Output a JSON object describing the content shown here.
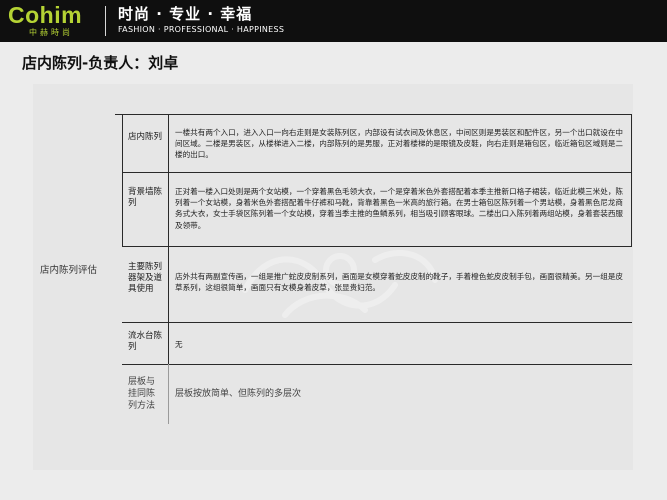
{
  "header": {
    "brand_name": "Cohim",
    "brand_sub": "中赫時尚",
    "slogan_cn": "时尚 · 专业 · 幸福",
    "slogan_en": "FASHION · PROFESSIONAL · HAPPINESS"
  },
  "title": "店内陈列-负责人：刘卓",
  "table": {
    "group_label": "店内陈列评估",
    "rows": [
      {
        "label": "店内陈列",
        "content": "一楼共有两个入口，进入入口一向右走则是女装陈列区，内部设有试衣间及休息区，中间区则是男装区和配件区，另一个出口就设在中间区域。二楼是男装区，从楼梯进入二楼，内部陈列的是男服，正对着楼梯的是眼镜及皮鞋，向右走则是箱包区，临近箱包区域则是二楼的出口。"
      },
      {
        "label": "背景墙陈列",
        "content": "正对着一楼入口处则是两个女站模，一个穿着黑色毛领大衣，一个是穿着米色外套搭配着本季主推新口格子裙装，临近此模三米处，陈列着一个女站模，身着米色外套搭配着牛仔裤和马靴，背靠着黑色一米高的旅行箱。在男士箱包区陈列着一个男站模，身着黑色尼龙商务式大衣，女士手袋区陈列着一个女站模，穿着当季主推的鱼鳞系列，相当吸引顾客眼球。二楼出口入陈列着两组站模，身着套装西服及领带。"
      },
      {
        "label": "主要陈列器架及道具使用",
        "content": "店外共有两副宣传画，一组是推广蛇皮皮制系列，画面是女模穿着蛇皮皮制的靴子，手着橙色蛇皮皮制手包，画面很精美。另一组是皮草系列，这组很简单，画面只有女模身着皮草，张显贵妇范。"
      },
      {
        "label": "流水台陈列",
        "content": "无"
      },
      {
        "label": "层板与挂同陈列方法",
        "content": "层板按放简单、但陈列的多层次"
      }
    ]
  }
}
